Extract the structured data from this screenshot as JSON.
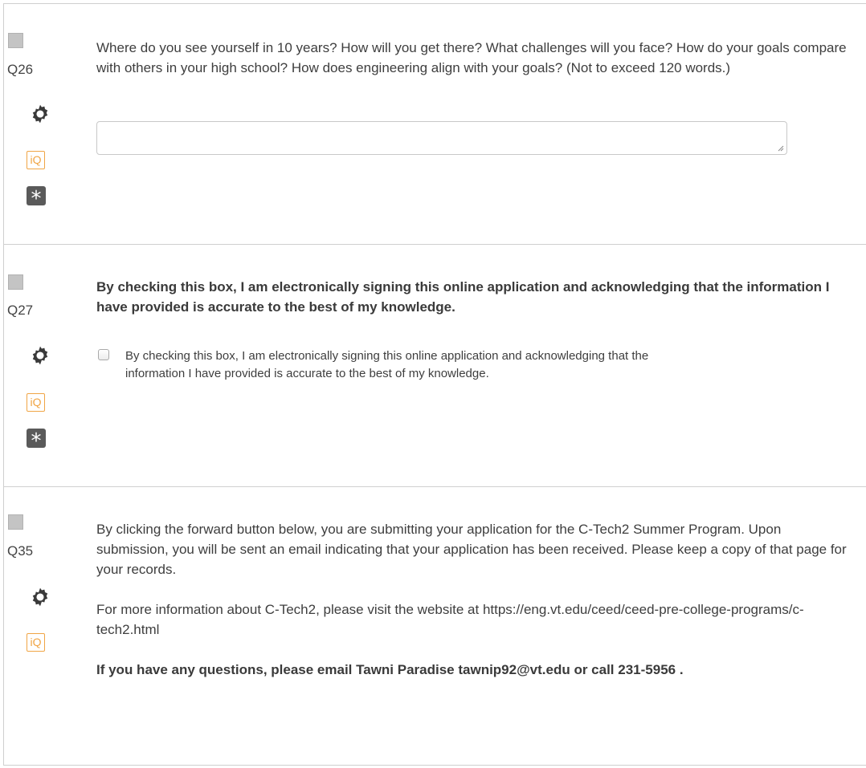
{
  "questions": [
    {
      "id": "Q26",
      "text": "Where do you see yourself in 10 years? How will you get there? What challenges will you face? How do your goals compare with others in your high school? How does engineering align with your goals? (Not to exceed 120 words.)",
      "required": true,
      "answer_value": ""
    },
    {
      "id": "Q27",
      "text": "By checking this box, I am electronically signing this online application and acknowledging that the information I have provided is accurate to the best of my knowledge.",
      "required": true,
      "choice_label": "By checking this box, I am electronically signing this online application and acknowledging that the information I have provided is accurate to the best of my knowledge.",
      "checked": false
    },
    {
      "id": "Q35",
      "paragraphs": [
        "By clicking the forward button below, you are submitting your application for the C-Tech2 Summer Program. Upon submission, you will be sent an email indicating that your application has been received.  Please keep a copy of that page for your records.",
        "For more information about C-Tech2, please visit the website at https://eng.vt.edu/ceed/ceed-pre-college-programs/c-tech2.html",
        "If you have any questions, please email Tawni Paradise tawnip92@vt.edu or call 231-5956 ."
      ],
      "required": false
    }
  ],
  "icons": {
    "iq_label": "iQ",
    "required_symbol": "*",
    "gear": "gear-icon"
  },
  "colors": {
    "iq_orange": "#f0a545",
    "required_bg": "#5a5a5a",
    "border": "#cfcfcf"
  }
}
